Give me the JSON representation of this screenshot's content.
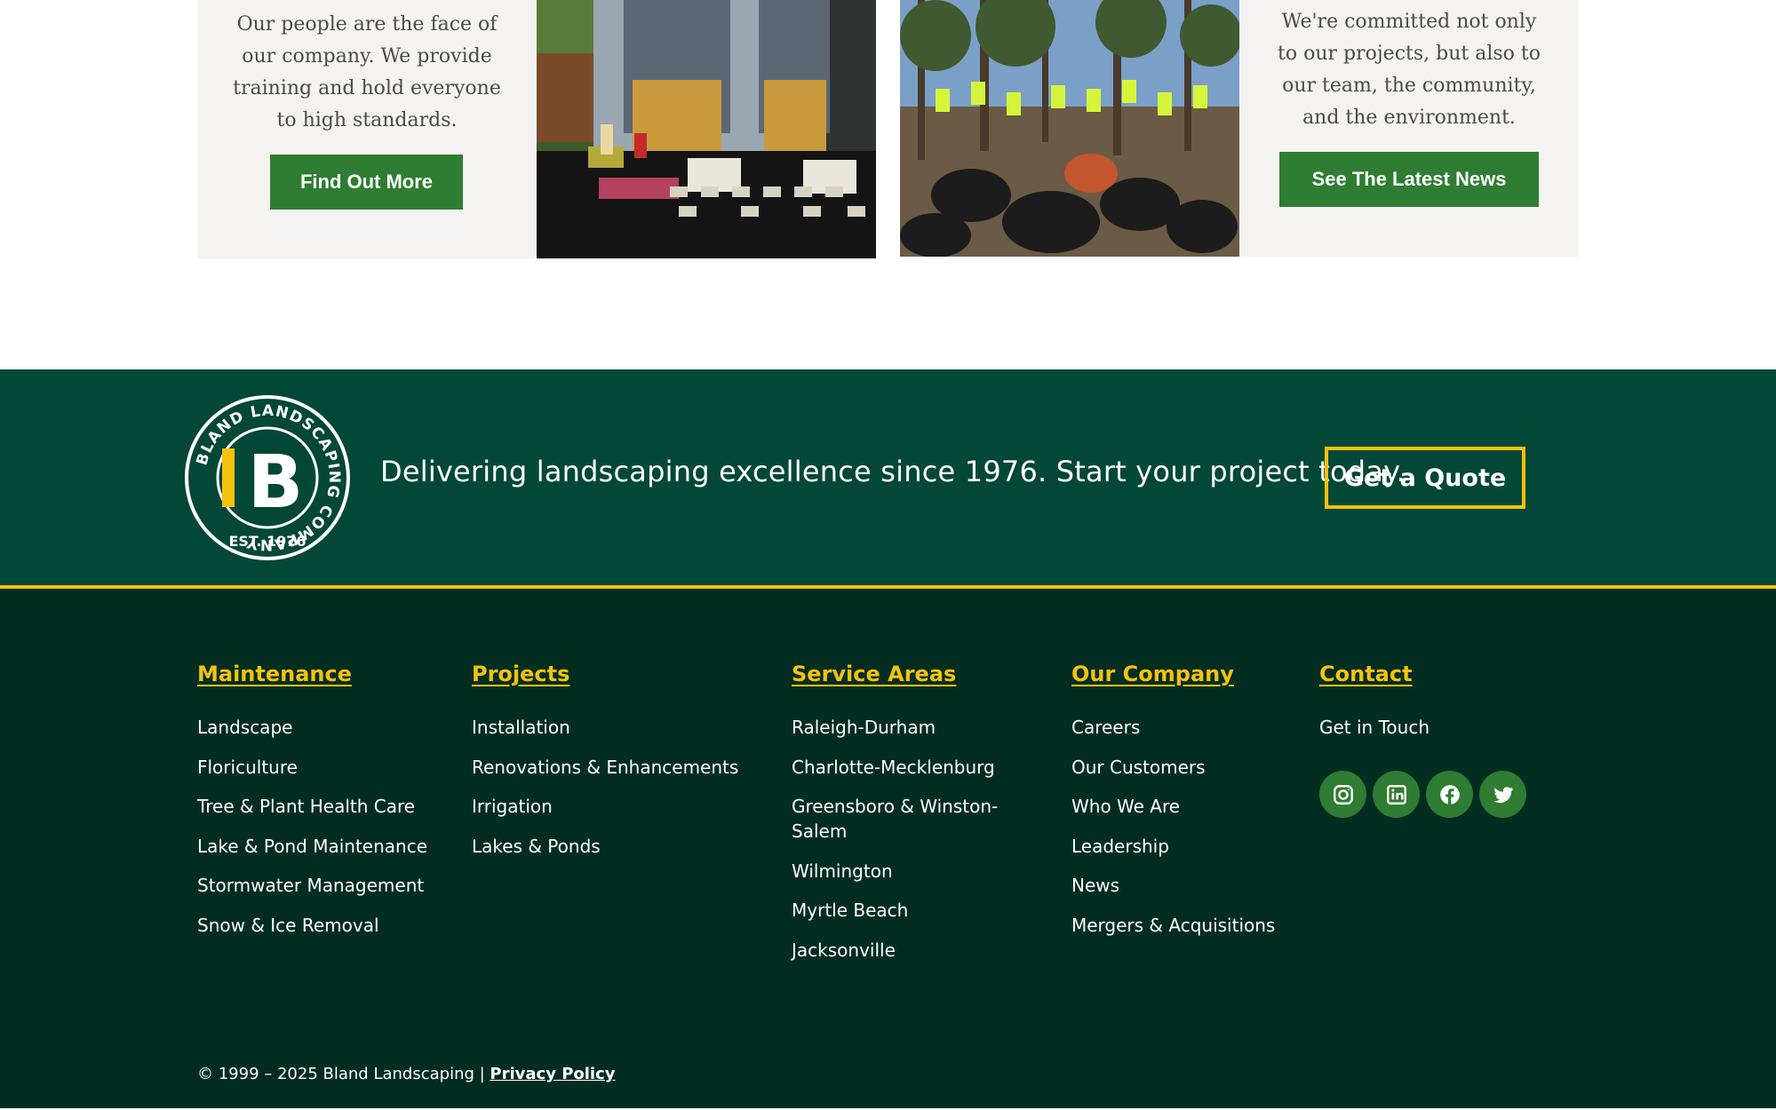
{
  "cards": {
    "people": {
      "text": "Our people are the face of our company. We provide training and hold everyone to high standards.",
      "button": "Find Out More"
    },
    "community": {
      "text": "We're committed not only to our projects, but also to our team, the community, and the environment.",
      "button": "See The Latest News"
    }
  },
  "cta": {
    "logo_text": "BLAND LANDSCAPING COMPANY",
    "logo_letter": "B",
    "logo_est": "EST. 1976",
    "tagline": "Delivering landscaping excellence since 1976. Start your project today.",
    "button": "Get a Quote"
  },
  "footer": {
    "columns": [
      {
        "heading": "Maintenance",
        "items": [
          "Landscape",
          "Floriculture",
          "Tree & Plant Health Care",
          "Lake & Pond Maintenance",
          "Stormwater Management",
          "Snow & Ice Removal"
        ]
      },
      {
        "heading": "Projects",
        "items": [
          "Installation",
          "Renovations & Enhancements",
          "Irrigation",
          "Lakes & Ponds"
        ]
      },
      {
        "heading": "Service Areas",
        "items": [
          "Raleigh-Durham",
          "Charlotte-Mecklenburg",
          "Greensboro & Winston-Salem",
          "Wilmington",
          "Myrtle Beach",
          "Jacksonville"
        ]
      },
      {
        "heading": "Our Company",
        "items": [
          "Careers",
          "Our Customers",
          "Who We Are",
          "Leadership",
          "News",
          "Mergers & Acquisitions"
        ]
      },
      {
        "heading": "Contact",
        "items": [
          "Get in Touch"
        ]
      }
    ],
    "social": [
      "instagram-icon",
      "linkedin-icon",
      "facebook-icon",
      "twitter-icon"
    ],
    "copyright": "© 1999 – 2025 Bland Landscaping | ",
    "privacy": "Privacy Policy"
  },
  "colors": {
    "brand_green": "#2e7d32",
    "band": "#034836",
    "footer": "#042d22",
    "accent_yellow": "#f4c20d"
  }
}
